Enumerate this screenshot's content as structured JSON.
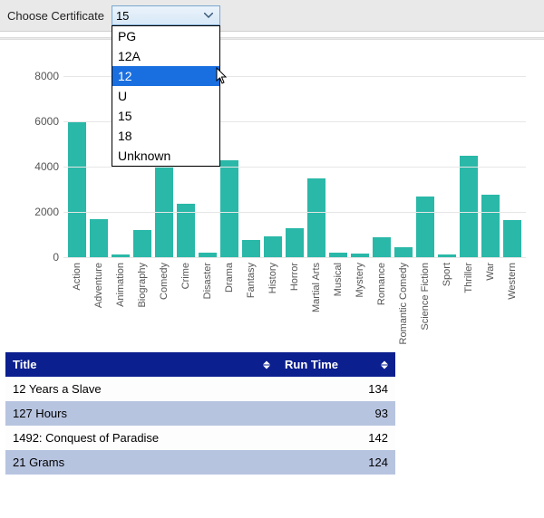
{
  "toolbar": {
    "label": "Choose Certificate",
    "selected": "15",
    "options": [
      "PG",
      "12A",
      "12",
      "U",
      "15",
      "18",
      "Unknown"
    ],
    "highlight_index": 2
  },
  "chart_data": {
    "type": "bar",
    "categories": [
      "Action",
      "Adventure",
      "Animation",
      "Biography",
      "Comedy",
      "Crime",
      "Disaster",
      "Drama",
      "Fantasy",
      "History",
      "Horror",
      "Martial Arts",
      "Musical",
      "Mystery",
      "Romance",
      "Romantic Comedy",
      "Science Fiction",
      "Sport",
      "Thriller",
      "War",
      "Western"
    ],
    "values": [
      6000,
      1700,
      120,
      1200,
      5900,
      2350,
      200,
      4300,
      780,
      920,
      1300,
      3500,
      220,
      180,
      900,
      450,
      2700,
      120,
      4500,
      2760,
      1650
    ],
    "title": "",
    "xlabel": "",
    "ylabel": "",
    "ylim": [
      0,
      8000
    ],
    "y_ticks": [
      0,
      2000,
      4000,
      6000,
      8000
    ]
  },
  "table": {
    "columns": {
      "title": "Title",
      "runtime": "Run Time"
    },
    "rows": [
      {
        "title": "12 Years a Slave",
        "runtime": "134"
      },
      {
        "title": "127 Hours",
        "runtime": "93"
      },
      {
        "title": "1492: Conquest of Paradise",
        "runtime": "142"
      },
      {
        "title": "21 Grams",
        "runtime": "124"
      }
    ]
  }
}
